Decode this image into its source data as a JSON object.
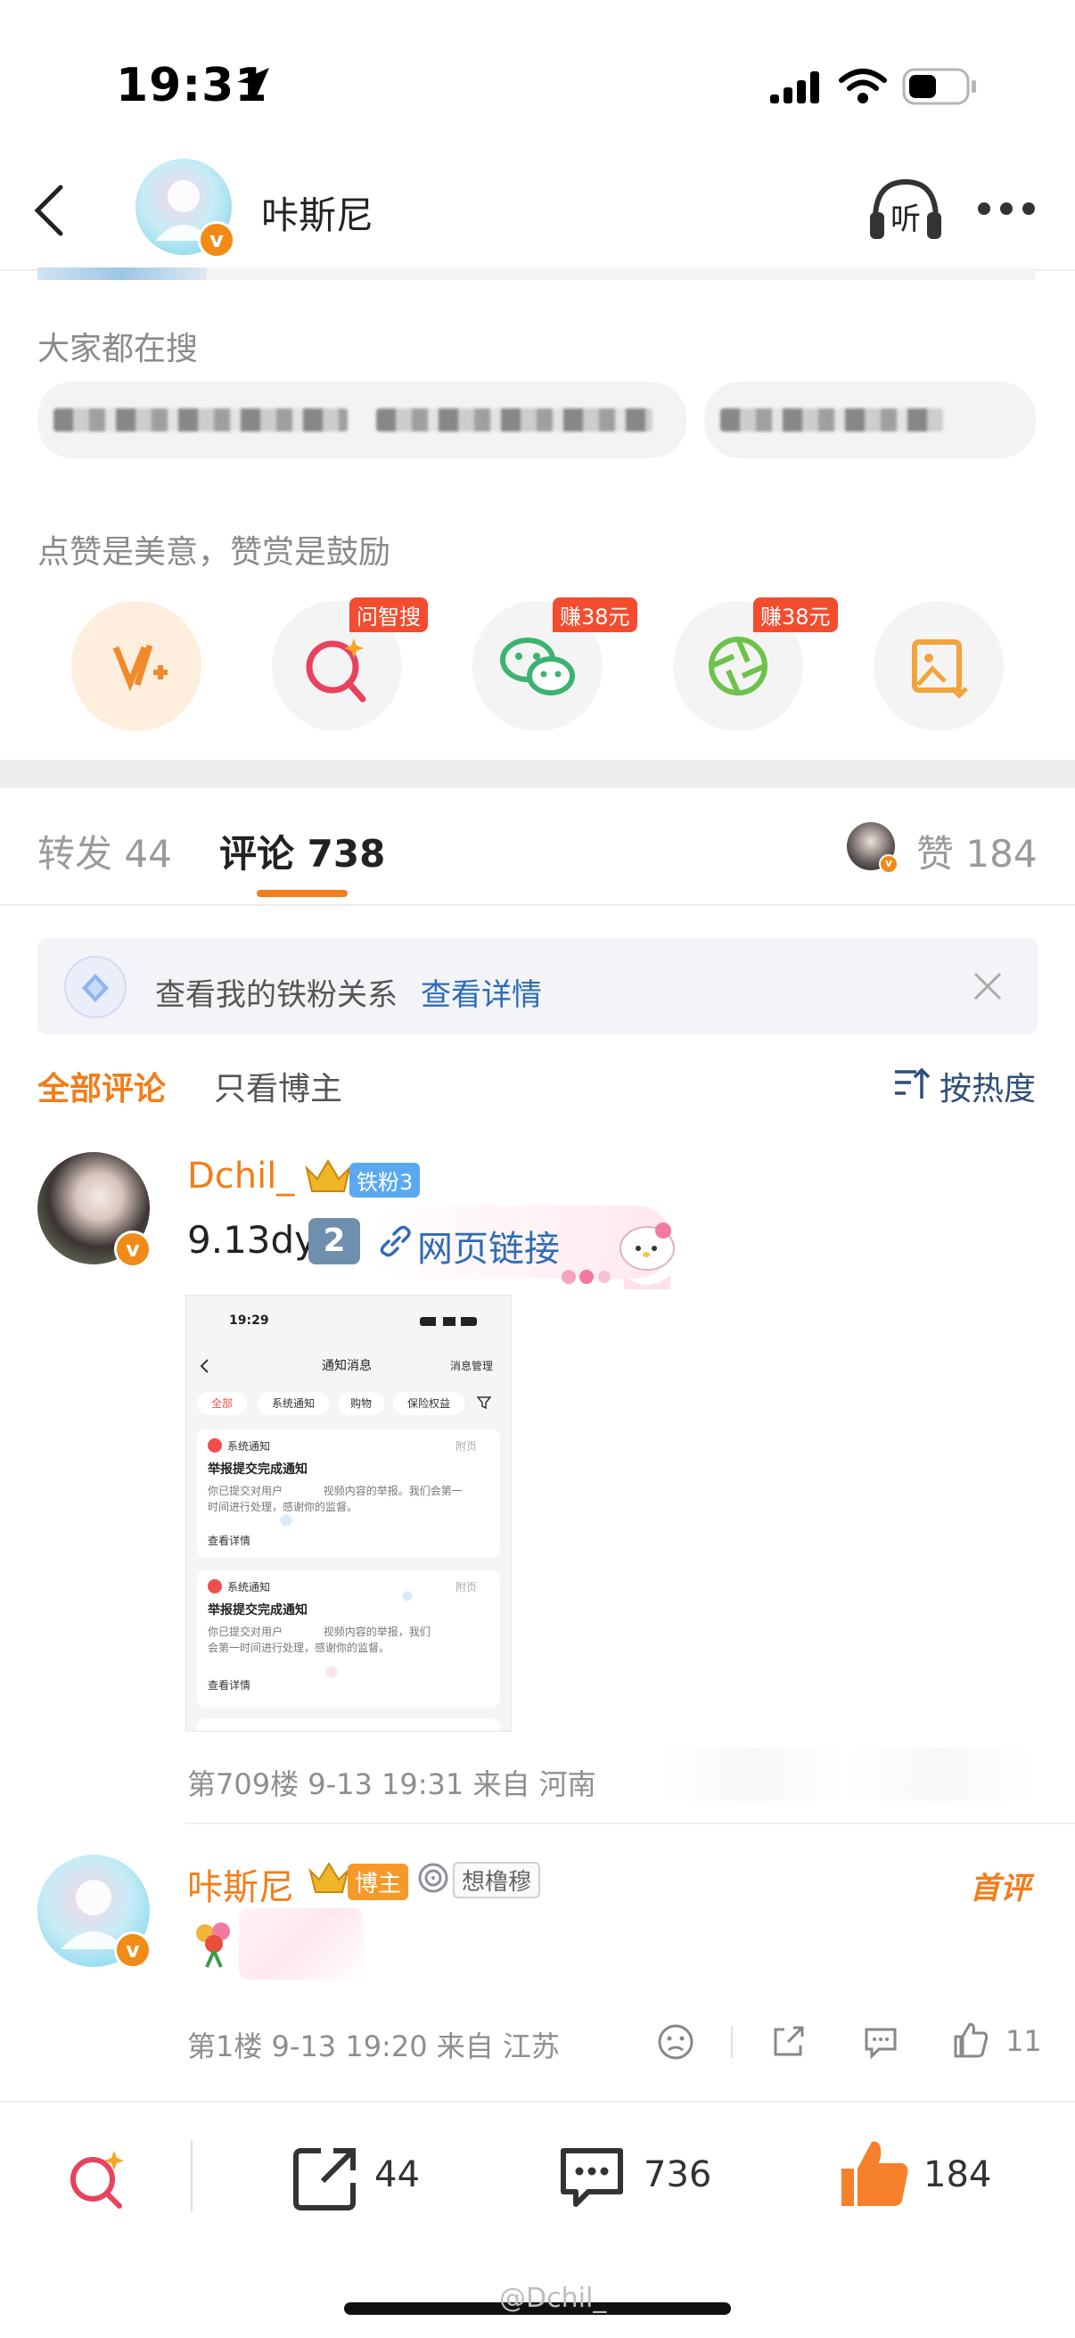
{
  "status_bar": {
    "time": "19:31"
  },
  "nav": {
    "title": "咔斯尼",
    "listen_label": "听"
  },
  "search_section": {
    "title": "大家都在搜"
  },
  "reward_section": {
    "title": "点赞是美意，赞赏是鼓励",
    "items": [
      {
        "icon": "vplus-reward-icon",
        "tag": ""
      },
      {
        "icon": "smart-search-icon",
        "tag": "问智搜"
      },
      {
        "icon": "wechat-icon",
        "tag": "赚38元"
      },
      {
        "icon": "moments-icon",
        "tag": "赚38元"
      },
      {
        "icon": "save-image-icon",
        "tag": ""
      }
    ]
  },
  "tabs": {
    "repost": {
      "label": "转发",
      "count": "44"
    },
    "comments": {
      "label": "评论",
      "count": "738"
    },
    "likes": {
      "label": "赞",
      "count": "184"
    }
  },
  "banner": {
    "text": "查看我的铁粉关系",
    "link": "查看详情"
  },
  "filters": {
    "all": "全部评论",
    "author_only": "只看博主",
    "sort": "按热度"
  },
  "comments": [
    {
      "username": "Dchil_",
      "fan_badge": "铁粉3",
      "text": "9.13dy",
      "number_badge": "2",
      "link_text": "网页链接",
      "meta": "第709楼 9-13 19:31 来自 河南",
      "screenshot": {
        "time": "19:29",
        "title": "通知消息",
        "manage": "消息管理",
        "chips": [
          "全部",
          "系统通知",
          "购物",
          "保险权益"
        ],
        "cards": [
          {
            "source": "系统通知",
            "tag": "附页",
            "title": "举报提交完成通知",
            "body1": "你已提交对用户            视频内容的举报。我们会第一",
            "body2": "时间进行处理，感谢你的监督。",
            "action": "查看详情"
          },
          {
            "source": "系统通知",
            "tag": "附页",
            "title": "举报提交完成通知",
            "body1": "你已提交对用户            视频内容的举报，我们",
            "body2": "会第一时间进行处理，感谢你的监督。",
            "action": "查看详情"
          }
        ]
      }
    },
    {
      "username": "咔斯尼",
      "author_badge": "博主",
      "tag_badge": "想橹穆",
      "first_comment_label": "首评",
      "meta": "第1楼 9-13 19:20 来自 江苏",
      "like_count": "11"
    }
  ],
  "bottom_bar": {
    "repost_count": "44",
    "comment_count": "736",
    "like_count": "184"
  },
  "watermark": "@Dchil_",
  "colors": {
    "accent": "#f27d1a",
    "link": "#2f6cb5",
    "tag_red": "#f34c2e",
    "like_orange": "#f7802c"
  }
}
